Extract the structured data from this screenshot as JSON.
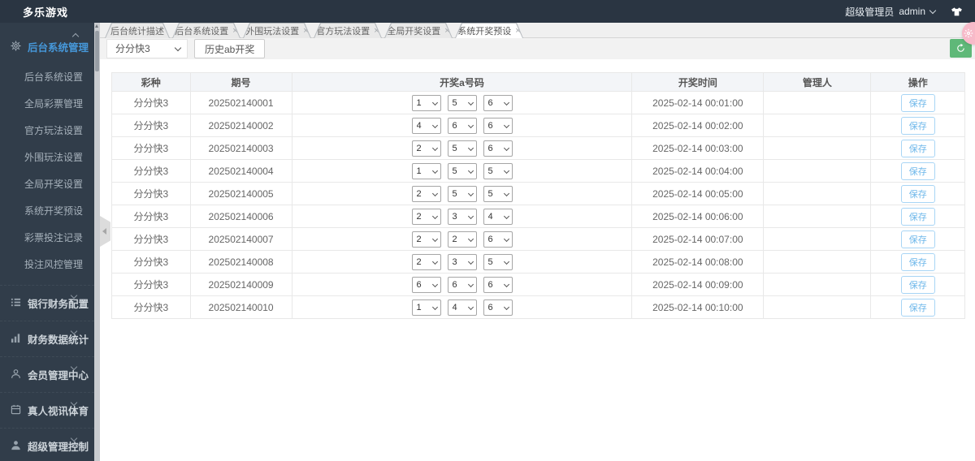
{
  "topbar": {
    "title": "多乐游戏",
    "user_role": "超级管理员",
    "user_name": "admin"
  },
  "sidebar": {
    "active_group": {
      "label": "后台系统管理"
    },
    "menu_items": [
      {
        "label": "后台系统设置"
      },
      {
        "label": "全局彩票管理"
      },
      {
        "label": "官方玩法设置"
      },
      {
        "label": "外围玩法设置"
      },
      {
        "label": "全局开奖设置"
      },
      {
        "label": "系统开奖预设"
      },
      {
        "label": "彩票投注记录"
      },
      {
        "label": "投注风控管理"
      }
    ],
    "groups": [
      {
        "label": "银行财务配置"
      },
      {
        "label": "财务数据统计"
      },
      {
        "label": "会员管理中心"
      },
      {
        "label": "真人视讯体育"
      },
      {
        "label": "超级管理控制"
      }
    ]
  },
  "tabs": {
    "close_symbol": "×",
    "items": [
      {
        "label": "后台统计描述"
      },
      {
        "label": "后台系统设置"
      },
      {
        "label": "外围玩法设置"
      },
      {
        "label": "官方玩法设置"
      },
      {
        "label": "全局开奖设置"
      },
      {
        "label": "系统开奖预设"
      }
    ]
  },
  "toolbar": {
    "lottery_select": "分分快3",
    "history_button": "历史ab开奖"
  },
  "table": {
    "headers": {
      "lottery": "彩种",
      "issue": "期号",
      "numbers": "开奖a号码",
      "time": "开奖时间",
      "manager": "管理人",
      "action": "操作"
    },
    "save_label": "保存",
    "rows": [
      {
        "lottery": "分分快3",
        "issue": "202502140001",
        "n1": "1",
        "n2": "5",
        "n3": "6",
        "time": "2025-02-14 00:01:00",
        "manager": ""
      },
      {
        "lottery": "分分快3",
        "issue": "202502140002",
        "n1": "4",
        "n2": "6",
        "n3": "6",
        "time": "2025-02-14 00:02:00",
        "manager": ""
      },
      {
        "lottery": "分分快3",
        "issue": "202502140003",
        "n1": "2",
        "n2": "5",
        "n3": "6",
        "time": "2025-02-14 00:03:00",
        "manager": ""
      },
      {
        "lottery": "分分快3",
        "issue": "202502140004",
        "n1": "1",
        "n2": "5",
        "n3": "5",
        "time": "2025-02-14 00:04:00",
        "manager": ""
      },
      {
        "lottery": "分分快3",
        "issue": "202502140005",
        "n1": "2",
        "n2": "5",
        "n3": "5",
        "time": "2025-02-14 00:05:00",
        "manager": ""
      },
      {
        "lottery": "分分快3",
        "issue": "202502140006",
        "n1": "2",
        "n2": "3",
        "n3": "4",
        "time": "2025-02-14 00:06:00",
        "manager": ""
      },
      {
        "lottery": "分分快3",
        "issue": "202502140007",
        "n1": "2",
        "n2": "2",
        "n3": "6",
        "time": "2025-02-14 00:07:00",
        "manager": ""
      },
      {
        "lottery": "分分快3",
        "issue": "202502140008",
        "n1": "2",
        "n2": "3",
        "n3": "5",
        "time": "2025-02-14 00:08:00",
        "manager": ""
      },
      {
        "lottery": "分分快3",
        "issue": "202502140009",
        "n1": "6",
        "n2": "6",
        "n3": "6",
        "time": "2025-02-14 00:09:00",
        "manager": ""
      },
      {
        "lottery": "分分快3",
        "issue": "202502140010",
        "n1": "1",
        "n2": "4",
        "n3": "6",
        "time": "2025-02-14 00:10:00",
        "manager": ""
      }
    ]
  },
  "colors": {
    "accent_blue": "#4698da",
    "green": "#5FB878",
    "pink": "#f7bac9"
  }
}
